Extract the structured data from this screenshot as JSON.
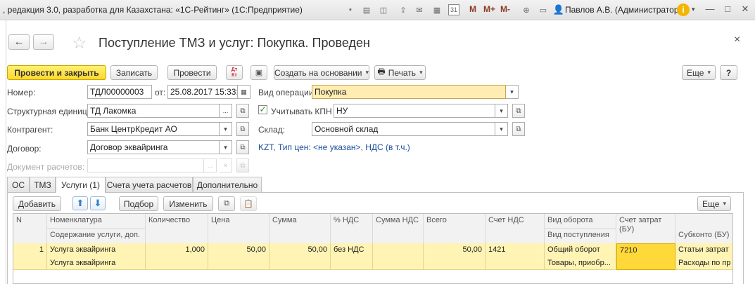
{
  "window": {
    "title": ", редакция 3.0, разработка для Казахстана: «1С-Рейтинг» (1С:Предприятие)",
    "user": "Павлов А.В. (Администратор)",
    "m_labels": [
      "M",
      "M+",
      "M-"
    ],
    "calendar_day": "31"
  },
  "document": {
    "title": "Поступление ТМЗ и услуг: Покупка. Проведен",
    "close": "×"
  },
  "toolbar": {
    "post_close": "Провести и закрыть",
    "save": "Записать",
    "post": "Провести",
    "dtkt": "Дт\nКт",
    "create_based": "Создать на основании",
    "print": "Печать",
    "more": "Еще",
    "help": "?"
  },
  "form": {
    "number_label": "Номер:",
    "number_value": "ТДЛ00000003",
    "date_label": "от:",
    "date_value": "25.08.2017 15:33:3",
    "operation_label": "Вид операции:",
    "operation_value": "Покупка",
    "unit_label": "Структурная единица:",
    "unit_value": "ТД Лакомка",
    "kpn_label": "Учитывать КПН",
    "kpn_checked": true,
    "kpn_value": "НУ",
    "contractor_label": "Контрагент:",
    "contractor_value": "Банк ЦентрКредит АО",
    "warehouse_label": "Склад:",
    "warehouse_value": "Основной склад",
    "contract_label": "Договор:",
    "contract_value": "Договор эквайринга",
    "price_link": "KZT, Тип цен: <не указан>, НДС (в т.ч.)",
    "settlement_doc_label": "Документ расчетов:",
    "settlement_doc_value": "",
    "ellipsis": "...",
    "clear": "×"
  },
  "tabs": [
    {
      "label": "ОС",
      "active": false
    },
    {
      "label": "ТМЗ",
      "active": false
    },
    {
      "label": "Услуги (1)",
      "active": true
    },
    {
      "label": "Счета учета расчетов",
      "active": false
    },
    {
      "label": "Дополнительно",
      "active": false
    }
  ],
  "table_toolbar": {
    "add": "Добавить",
    "pick": "Подбор",
    "edit": "Изменить",
    "more": "Еще"
  },
  "table": {
    "headers": {
      "n": "N",
      "nomenclature": "Номенклатура",
      "content": "Содержание услуги, доп.",
      "quantity": "Количество",
      "price": "Цена",
      "sum": "Сумма",
      "vat_rate": "% НДС",
      "vat_sum": "Сумма НДС",
      "total": "Всего",
      "vat_account": "Счет НДС",
      "turnover_type": "Вид оборота",
      "receipt_type": "Вид поступления",
      "cost_account": "Счет затрат (БУ)",
      "subconto": "Субконто (БУ)"
    },
    "rows": [
      {
        "n": "1",
        "nomenclature": "Услуга эквайринга",
        "content": "Услуга эквайринга",
        "quantity": "1,000",
        "price": "50,00",
        "sum": "50,00",
        "vat_rate": "без НДС",
        "vat_sum": "",
        "total": "50,00",
        "vat_account": "1421",
        "turnover_type": "Общий оборот",
        "receipt_type": "Товары, приобр...",
        "cost_account": "7210",
        "subconto1": "Статьи затрат",
        "subconto2": "Расходы по пр"
      }
    ]
  },
  "colors": {
    "accent_yellow": "#ffd82c",
    "row_highlight": "#fff4b3",
    "cell_selected": "#ffd83a",
    "link_blue": "#1a4f9c"
  }
}
